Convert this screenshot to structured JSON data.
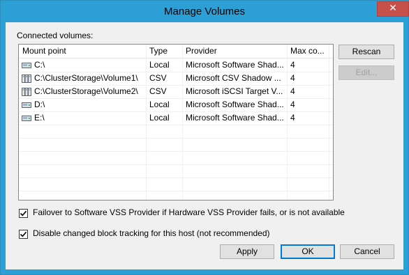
{
  "window": {
    "title": "Manage Volumes",
    "close_glyph": "✕"
  },
  "volumes": {
    "label": "Connected volumes:",
    "columns": [
      {
        "label": "Mount point"
      },
      {
        "label": "Type"
      },
      {
        "label": "Provider"
      },
      {
        "label": "Max co..."
      }
    ],
    "rows": [
      {
        "icon": "disk-icon",
        "mount": "C:\\",
        "type": "Local",
        "provider": "Microsoft Software Shad...",
        "max": "4"
      },
      {
        "icon": "cluster-volume-icon",
        "mount": "C:\\ClusterStorage\\Volume1\\",
        "type": "CSV",
        "provider": "Microsoft CSV Shadow ...",
        "max": "4"
      },
      {
        "icon": "cluster-volume-icon",
        "mount": "C:\\ClusterStorage\\Volume2\\",
        "type": "CSV",
        "provider": "Microsoft iSCSI Target V...",
        "max": "4"
      },
      {
        "icon": "disk-icon",
        "mount": "D:\\",
        "type": "Local",
        "provider": "Microsoft Software Shad...",
        "max": "4"
      },
      {
        "icon": "disk-icon",
        "mount": "E:\\",
        "type": "Local",
        "provider": "Microsoft Software Shad...",
        "max": "4"
      }
    ]
  },
  "side_buttons": {
    "rescan": "Rescan",
    "edit": "Edit..."
  },
  "options": {
    "failover": {
      "label": "Failover to Software VSS Provider if Hardware VSS Provider fails, or is not available",
      "checked": true
    },
    "disable_cbt": {
      "label": "Disable changed block tracking for this host (not recommended)",
      "checked": true
    }
  },
  "footer": {
    "apply": "Apply",
    "ok": "OK",
    "cancel": "Cancel"
  },
  "colors": {
    "titlebar": "#2b9fd6",
    "close": "#c7504b",
    "accent": "#0078d7"
  }
}
